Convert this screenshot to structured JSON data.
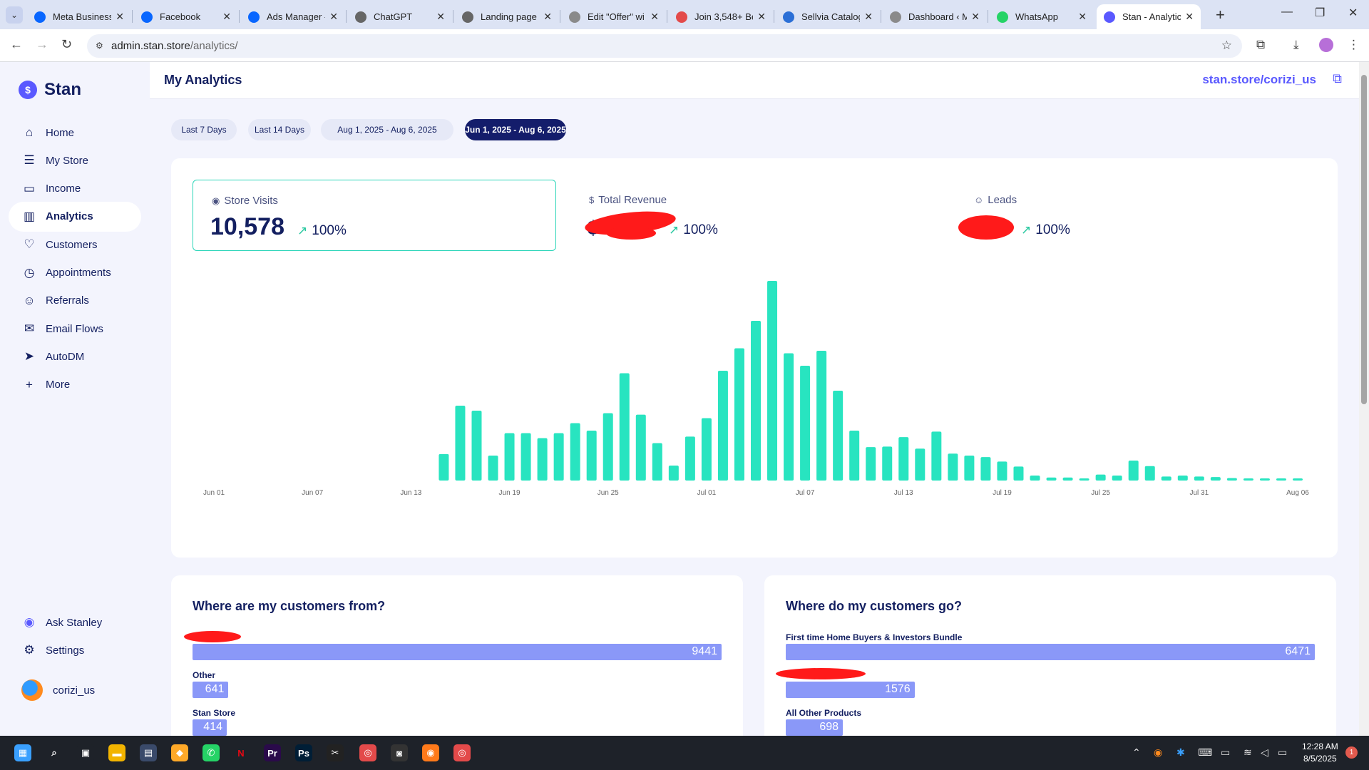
{
  "browser": {
    "tabs": [
      {
        "label": "Meta Business",
        "icon": "meta-icon",
        "color": "#0866ff"
      },
      {
        "label": "Facebook",
        "icon": "meta-icon",
        "color": "#0866ff"
      },
      {
        "label": "Ads Manager -",
        "icon": "meta-icon",
        "color": "#0866ff"
      },
      {
        "label": "ChatGPT",
        "icon": "openai-icon",
        "color": "#666666"
      },
      {
        "label": "Landing page",
        "icon": "openai-icon",
        "color": "#666666"
      },
      {
        "label": "Edit \"Offer\" wi",
        "icon": "globe-icon",
        "color": "#8a8a8a"
      },
      {
        "label": "Join 3,548+ Be",
        "icon": "megaphone-icon",
        "color": "#e34a4a"
      },
      {
        "label": "Sellvia Catalog",
        "icon": "sellvia-icon",
        "color": "#2b6fd6"
      },
      {
        "label": "Dashboard ‹ M",
        "icon": "globe-icon",
        "color": "#8a8a8a"
      },
      {
        "label": "WhatsApp",
        "icon": "whatsapp-icon",
        "color": "#25d366"
      },
      {
        "label": "Stan - Analytic",
        "icon": "stan-icon",
        "color": "#5a59ff"
      }
    ],
    "url_host": "admin.stan.store",
    "url_path": "/analytics/"
  },
  "sidebar": {
    "brand": "Stan",
    "items": [
      {
        "label": "Home",
        "icon": "home-icon",
        "glyph": "⌂"
      },
      {
        "label": "My Store",
        "icon": "store-icon",
        "glyph": "☰"
      },
      {
        "label": "Income",
        "icon": "wallet-icon",
        "glyph": "▭"
      },
      {
        "label": "Analytics",
        "icon": "bar-chart-icon",
        "glyph": "▥"
      },
      {
        "label": "Customers",
        "icon": "heart-icon",
        "glyph": "♡"
      },
      {
        "label": "Appointments",
        "icon": "clock-icon",
        "glyph": "◷"
      },
      {
        "label": "Referrals",
        "icon": "smiley-icon",
        "glyph": "☺"
      },
      {
        "label": "Email Flows",
        "icon": "mail-icon",
        "glyph": "✉"
      },
      {
        "label": "AutoDM",
        "icon": "send-icon",
        "glyph": "➤"
      },
      {
        "label": "More",
        "icon": "plus-icon",
        "glyph": "+"
      }
    ],
    "active_index": 3,
    "bottom": [
      {
        "label": "Ask Stanley",
        "icon": "robot-icon",
        "glyph": "◉"
      },
      {
        "label": "Settings",
        "icon": "gear-icon",
        "glyph": "⚙"
      }
    ],
    "username": "corizi_us"
  },
  "header": {
    "title": "My Analytics",
    "store_link": "stan.store/corizi_us"
  },
  "ranges": [
    "Last 7 Days",
    "Last 14 Days",
    "Aug 1, 2025 - Aug 6, 2025",
    "Jun 1, 2025 - Aug 6, 2025"
  ],
  "active_range": 3,
  "stats": [
    {
      "label": "Store Visits",
      "value": "10,578",
      "trend": "100%"
    },
    {
      "label": "Total Revenue",
      "value": "$",
      "trend": "100%"
    },
    {
      "label": "Leads",
      "value": "",
      "trend": "100%"
    }
  ],
  "chart_data": {
    "type": "bar",
    "series_name": "Store Visits",
    "x_tick_labels": [
      "Jun 01",
      "Jun 07",
      "Jun 13",
      "Jun 19",
      "Jun 25",
      "Jul 01",
      "Jul 07",
      "Jul 13",
      "Jul 19",
      "Jul 25",
      "Jul 31",
      "Aug 06"
    ],
    "x_tick_days": [
      0,
      6,
      12,
      18,
      24,
      30,
      36,
      42,
      48,
      54,
      60,
      66
    ],
    "categories": [
      "Jun 01",
      "Jun 02",
      "Jun 03",
      "Jun 04",
      "Jun 05",
      "Jun 06",
      "Jun 07",
      "Jun 08",
      "Jun 09",
      "Jun 10",
      "Jun 11",
      "Jun 12",
      "Jun 13",
      "Jun 14",
      "Jun 15",
      "Jun 16",
      "Jun 17",
      "Jun 18",
      "Jun 19",
      "Jun 20",
      "Jun 21",
      "Jun 22",
      "Jun 23",
      "Jun 24",
      "Jun 25",
      "Jun 26",
      "Jun 27",
      "Jun 28",
      "Jun 29",
      "Jun 30",
      "Jul 01",
      "Jul 02",
      "Jul 03",
      "Jul 04",
      "Jul 05",
      "Jul 06",
      "Jul 07",
      "Jul 08",
      "Jul 09",
      "Jul 10",
      "Jul 11",
      "Jul 12",
      "Jul 13",
      "Jul 14",
      "Jul 15",
      "Jul 16",
      "Jul 17",
      "Jul 18",
      "Jul 19",
      "Jul 20",
      "Jul 21",
      "Jul 22",
      "Jul 23",
      "Jul 24",
      "Jul 25",
      "Jul 26",
      "Jul 27",
      "Jul 28",
      "Jul 29",
      "Jul 30",
      "Jul 31",
      "Aug 01",
      "Aug 02",
      "Aug 03",
      "Aug 04",
      "Aug 05",
      "Aug 06"
    ],
    "values": [
      0,
      0,
      0,
      0,
      0,
      0,
      0,
      0,
      0,
      0,
      0,
      0,
      0,
      0,
      53,
      150,
      140,
      50,
      95,
      95,
      85,
      95,
      115,
      100,
      135,
      215,
      132,
      75,
      30,
      88,
      125,
      220,
      265,
      320,
      400,
      255,
      230,
      260,
      180,
      100,
      67,
      68,
      87,
      64,
      98,
      54,
      50,
      47,
      38,
      28,
      10,
      6,
      6,
      4,
      12,
      10,
      40,
      29,
      8,
      10,
      8,
      7,
      5,
      4,
      3,
      3,
      2
    ],
    "grid": false,
    "legend": "none"
  },
  "customers_from": {
    "title": "Where are my customers from?",
    "rows": [
      {
        "label": "",
        "value": 9441
      },
      {
        "label": "Other",
        "value": 641
      },
      {
        "label": "Stan Store",
        "value": 414
      }
    ]
  },
  "customers_go": {
    "title": "Where do my customers go?",
    "rows": [
      {
        "label": "First time Home Buyers & Investors Bundle",
        "value": 6471
      },
      {
        "label": "",
        "value": 1576
      },
      {
        "label": "All Other Products",
        "value": 698
      }
    ]
  },
  "taskbar": {
    "apps": [
      {
        "icon": "windows-start-icon",
        "glyph": "▦",
        "color": "#3aa0ff"
      },
      {
        "icon": "search-icon",
        "glyph": "⌕",
        "color": "#1e2229"
      },
      {
        "icon": "task-view-icon",
        "glyph": "▣",
        "color": "#1e2229"
      },
      {
        "icon": "file-explorer-icon",
        "glyph": "▬",
        "color": "#f2b400"
      },
      {
        "icon": "calculator-icon",
        "glyph": "▤",
        "color": "#3a4a6a"
      },
      {
        "icon": "app-icon",
        "glyph": "◆",
        "color": "#ffa928"
      },
      {
        "icon": "whatsapp-icon",
        "glyph": "✆",
        "color": "#25d366"
      },
      {
        "icon": "netflix-icon",
        "glyph": "N",
        "color": "#1e2229"
      },
      {
        "icon": "premiere-icon",
        "glyph": "Pr",
        "color": "#2a0a4a"
      },
      {
        "icon": "photoshop-icon",
        "glyph": "Ps",
        "color": "#001e36"
      },
      {
        "icon": "capcut-icon",
        "glyph": "✂",
        "color": "#222222"
      },
      {
        "icon": "chrome-icon",
        "glyph": "◎",
        "color": "#e34a4a"
      },
      {
        "icon": "camera-icon",
        "glyph": "◙",
        "color": "#333333"
      },
      {
        "icon": "firefox-icon",
        "glyph": "◉",
        "color": "#ff7a1a"
      },
      {
        "icon": "chrome-profile-icon",
        "glyph": "◎",
        "color": "#e34a4a"
      }
    ],
    "time": "12:28 AM",
    "date": "8/5/2025",
    "notifications": "1"
  }
}
